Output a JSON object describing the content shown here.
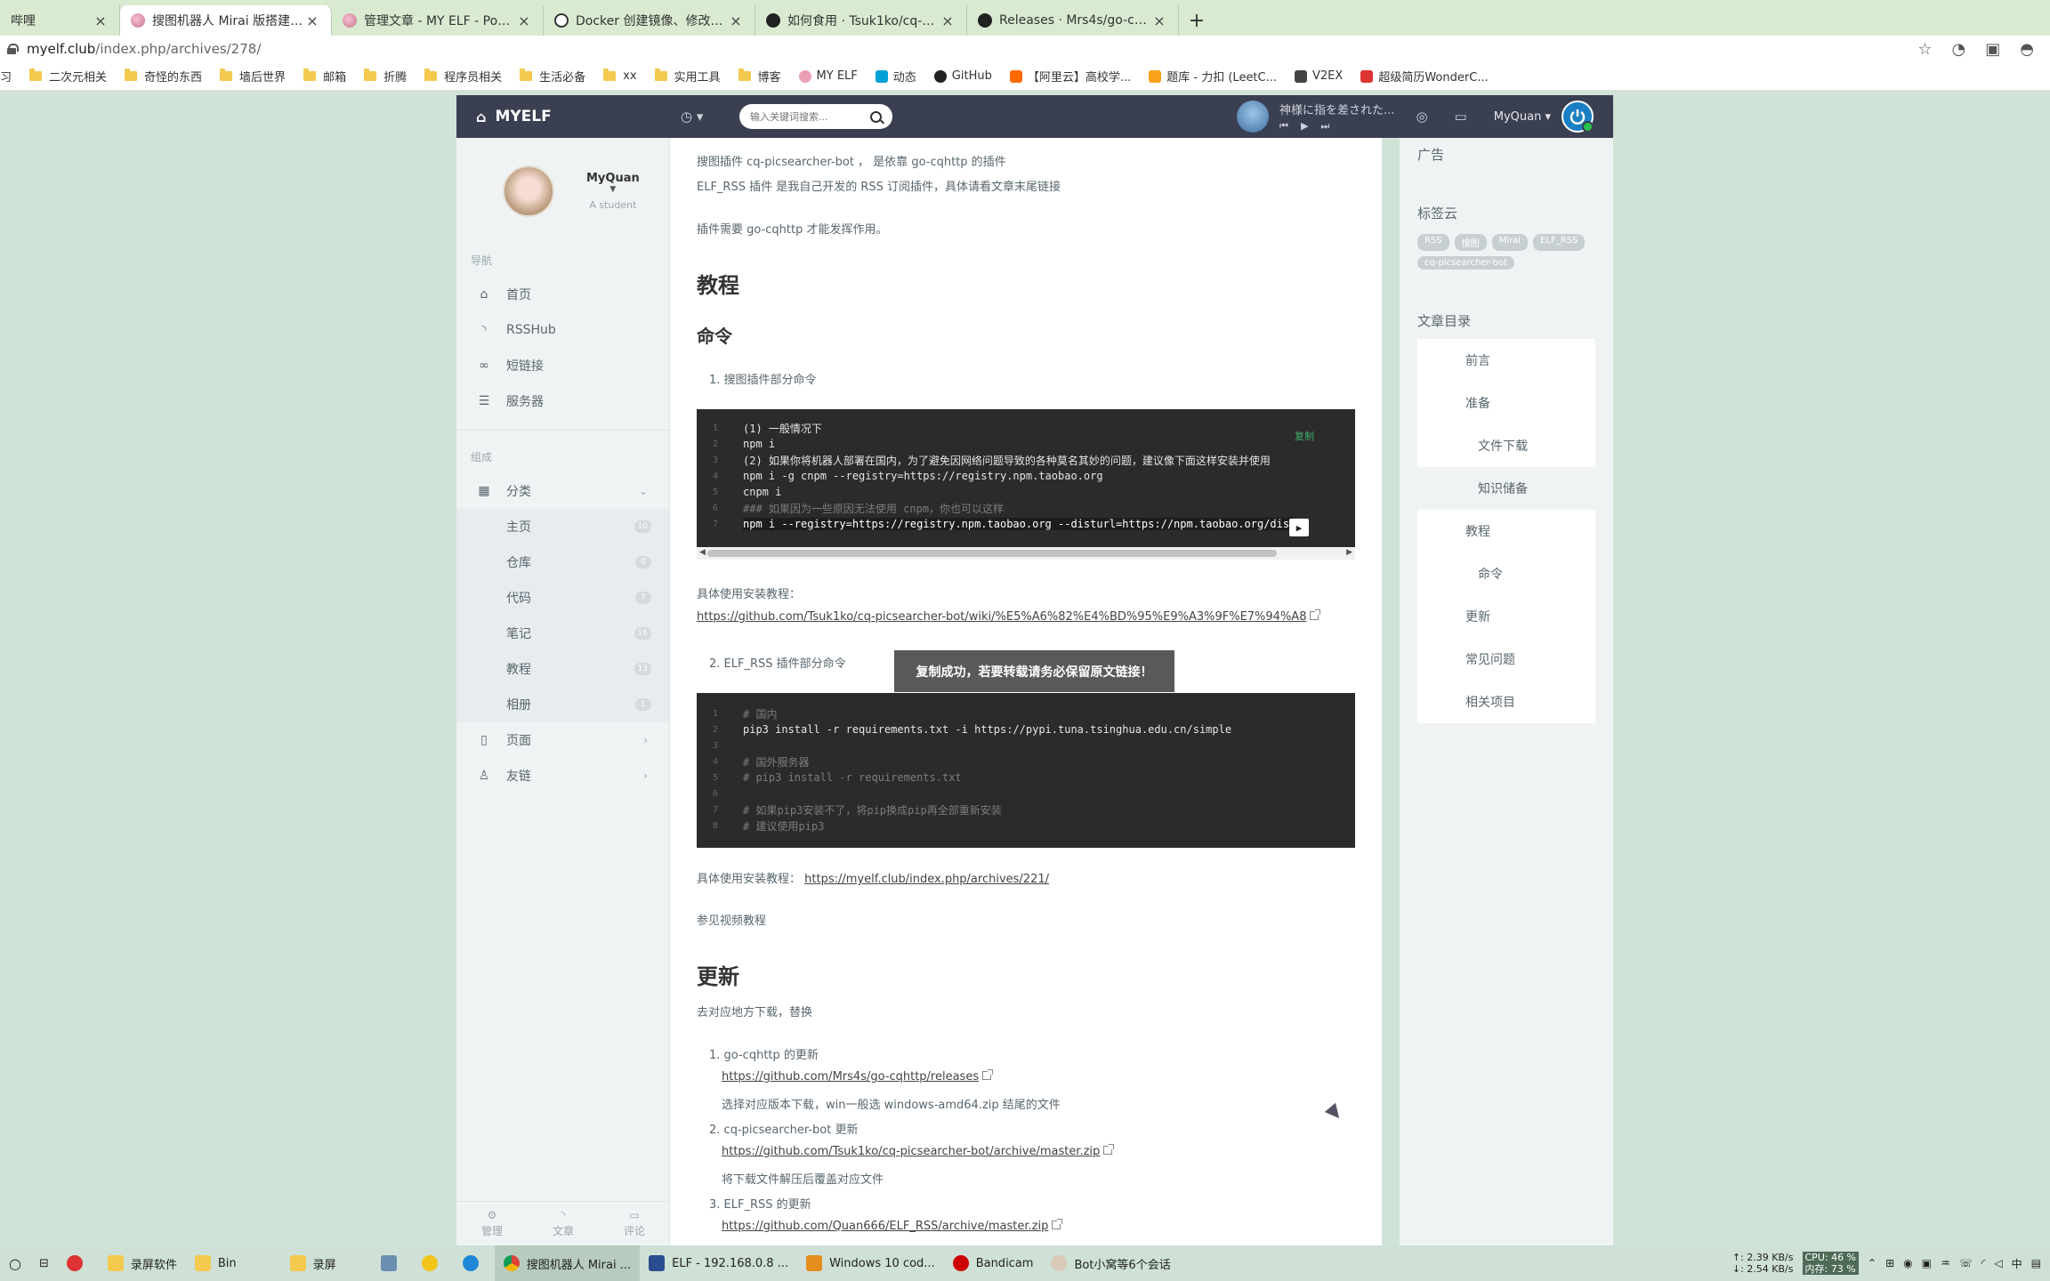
{
  "browser": {
    "tabs": [
      {
        "title": "哔哩",
        "active": false
      },
      {
        "title": "搜图机器人 Mirai 版搭建教程 - M",
        "active": true
      },
      {
        "title": "管理文章 - MY ELF - Powered b",
        "active": false
      },
      {
        "title": "Docker 创建镜像、修改、上传镜",
        "active": false
      },
      {
        "title": "如何食用 · Tsuk1ko/cq-picsear",
        "active": false
      },
      {
        "title": "Releases · Mrs4s/go-cqhttp",
        "active": false
      }
    ],
    "new_tab": "+",
    "url_host": "myelf.club",
    "url_path": "/index.php/archives/278/",
    "bookmarks": [
      "习",
      "二次元相关",
      "奇怪的东西",
      "墙后世界",
      "邮箱",
      "折腾",
      "程序员相关",
      "生活必备",
      "xx",
      "实用工具",
      "博客",
      "MY ELF",
      "动态",
      "GitHub",
      "【阿里云】高校学...",
      "题库 - 力扣 (LeetC...",
      "V2EX",
      "超级简历WonderC..."
    ]
  },
  "header": {
    "brand": "MYELF",
    "search_placeholder": "输入关键词搜索...",
    "player_title": "神様に指を差された...",
    "user": "MyQuan"
  },
  "sidebar": {
    "profile_name": "MyQuan",
    "profile_role": "A student",
    "nav_label": "导航",
    "nav_items": [
      {
        "label": "首页",
        "icon": "home-icon"
      },
      {
        "label": "RSSHub",
        "icon": "rss-icon"
      },
      {
        "label": "短链接",
        "icon": "link-icon"
      },
      {
        "label": "服务器",
        "icon": "server-icon"
      }
    ],
    "group_label": "组成",
    "category_label": "分类",
    "categories": [
      {
        "label": "主页",
        "count": "10"
      },
      {
        "label": "仓库",
        "count": "0"
      },
      {
        "label": "代码",
        "count": "7"
      },
      {
        "label": "笔记",
        "count": "16"
      },
      {
        "label": "教程",
        "count": "13"
      },
      {
        "label": "相册",
        "count": "1"
      }
    ],
    "pages_label": "页面",
    "friends_label": "友链",
    "footer": [
      "管理",
      "文章",
      "评论"
    ]
  },
  "content": {
    "line1": "搜图插件 cq-picsearcher-bot ， 是依靠 go-cqhttp 的插件",
    "line2": "ELF_RSS 插件 是我自己开发的 RSS 订阅插件，具体请看文章末尾链接",
    "line3": "插件需要 go-cqhttp 才能发挥作用。",
    "h_tutorial": "教程",
    "h_commands": "命令",
    "list1": "搜图插件部分命令",
    "code1": [
      {
        "n": "1",
        "t": "(1) 一般情况下",
        "kind": "text"
      },
      {
        "n": "2",
        "t": "npm i",
        "kind": "text"
      },
      {
        "n": "3",
        "t": "(2) 如果你将机器人部署在国内，为了避免因网络问题导致的各种莫名其妙的问题，建议像下面这样安装并使用",
        "kind": "text"
      },
      {
        "n": "4",
        "t": "npm i -g cnpm --registry=https://registry.npm.taobao.org",
        "kind": "text"
      },
      {
        "n": "5",
        "t": "cnpm i",
        "kind": "text"
      },
      {
        "n": "6",
        "t": "### 如果因为一些原因无法使用 cnpm，你也可以这样",
        "kind": "comment"
      },
      {
        "n": "7",
        "t": "npm i --registry=https://registry.npm.taobao.org --disturl=https://npm.taobao.org/dist",
        "kind": "hl"
      }
    ],
    "copy_label": "复制",
    "install_label1": "具体使用安装教程：",
    "install_link1": "https://github.com/Tsuk1ko/cq-picsearcher-bot/wiki/%E5%A6%82%E4%BD%95%E9%A3%9F%E7%94%A8",
    "list2": "ELF_RSS 插件部分命令",
    "code2": [
      {
        "n": "1",
        "t": "# 国内",
        "kind": "comment"
      },
      {
        "n": "2",
        "t": "pip3 install -r requirements.txt -i https://pypi.tuna.tsinghua.edu.cn/simple",
        "kind": "text"
      },
      {
        "n": "3",
        "t": "",
        "kind": "text"
      },
      {
        "n": "4",
        "t": "# 国外服务器",
        "kind": "comment"
      },
      {
        "n": "5",
        "t": "# pip3 install -r requirements.txt",
        "kind": "comment"
      },
      {
        "n": "6",
        "t": "",
        "kind": "text"
      },
      {
        "n": "7",
        "t": "# 如果pip3安装不了，将pip换成pip再全部重新安装",
        "kind": "comment"
      },
      {
        "n": "8",
        "t": "# 建议使用pip3",
        "kind": "comment"
      }
    ],
    "install_label2": "具体使用安装教程：",
    "install_link2": "https://myelf.club/index.php/archives/221/",
    "video_ref": "参见视频教程",
    "h_update": "更新",
    "update_desc": "去对应地方下载，替换",
    "updates": [
      {
        "title": "go-cqhttp 的更新",
        "link": "https://github.com/Mrs4s/go-cqhttp/releases",
        "note": "选择对应版本下载，win一般选 windows-amd64.zip 结尾的文件"
      },
      {
        "title": "cq-picsearcher-bot 更新",
        "link": "https://github.com/Tsuk1ko/cq-picsearcher-bot/archive/master.zip",
        "note": "将下载文件解压后覆盖对应文件"
      },
      {
        "title": "ELF_RSS 的更新",
        "link": "https://github.com/Quan666/ELF_RSS/archive/master.zip",
        "note": ""
      }
    ],
    "toast": "复制成功，若要转载请务必保留原文链接！"
  },
  "rightbar": {
    "ad_title": "广告",
    "tags_title": "标签云",
    "tags": [
      "RSS",
      "搜图",
      "Mirai",
      "ELF_RSS",
      "cq-picsearcher-bot"
    ],
    "toc_title": "文章目录",
    "toc": [
      {
        "label": "前言",
        "level": 1
      },
      {
        "label": "准备",
        "level": 1
      },
      {
        "label": "文件下载",
        "level": 2
      },
      {
        "label": "知识储备",
        "level": 2
      },
      {
        "label": "教程",
        "level": 1
      },
      {
        "label": "命令",
        "level": 2
      },
      {
        "label": "更新",
        "level": 1
      },
      {
        "label": "常见问题",
        "level": 1
      },
      {
        "label": "相关项目",
        "level": 1
      }
    ]
  },
  "taskbar": {
    "items": [
      "录屏软件",
      "Bin",
      "录屏",
      "搜图机器人 Mirai ...",
      "ELF - 192.168.0.8 ...",
      "Windows 10 cod...",
      "Bandicam",
      "Bot小窝等6个会话"
    ],
    "net_up": "↑: 2.39 KB/s",
    "net_down": "↓: 2.54 KB/s",
    "cpu": "CPU: 46 %",
    "mem": "内存: 73 %"
  }
}
